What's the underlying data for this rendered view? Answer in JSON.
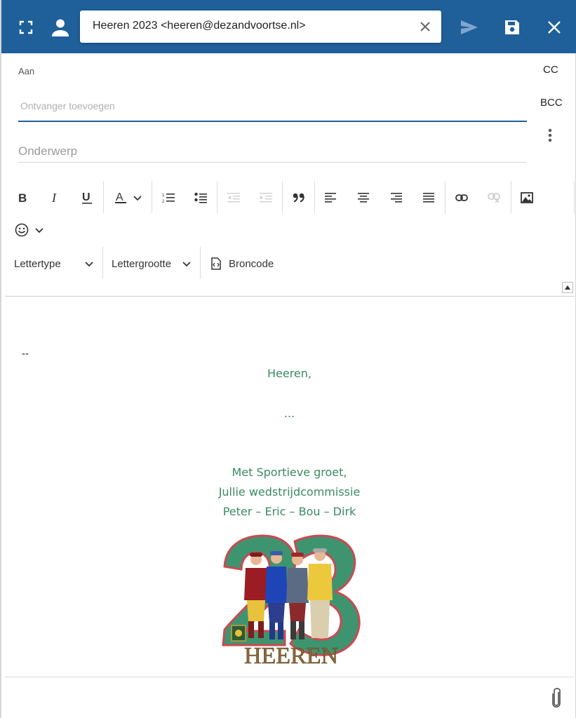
{
  "header": {
    "from": "Heeren 2023 <heeren@dezandvoortse.nl>"
  },
  "address": {
    "to_label": "Aan",
    "recipient_placeholder": "Ontvanger toevoegen",
    "cc_label": "CC",
    "bcc_label": "BCC",
    "subject_placeholder": "Onderwerp"
  },
  "toolbar": {
    "font_label": "Lettertype",
    "size_label": "Lettergrootte",
    "source_label": "Broncode"
  },
  "body": {
    "dashes": "--",
    "greeting": "Heeren,",
    "ellipsis": "...",
    "closing": "Met Sportieve groet,",
    "committee": "Jullie wedstrijdcommissie",
    "names": "Peter – Eric – Bou – Dirk",
    "logo_text": "HEEREN"
  },
  "colors": {
    "header": "#1f5f9a",
    "signature": "#3b8a63"
  }
}
